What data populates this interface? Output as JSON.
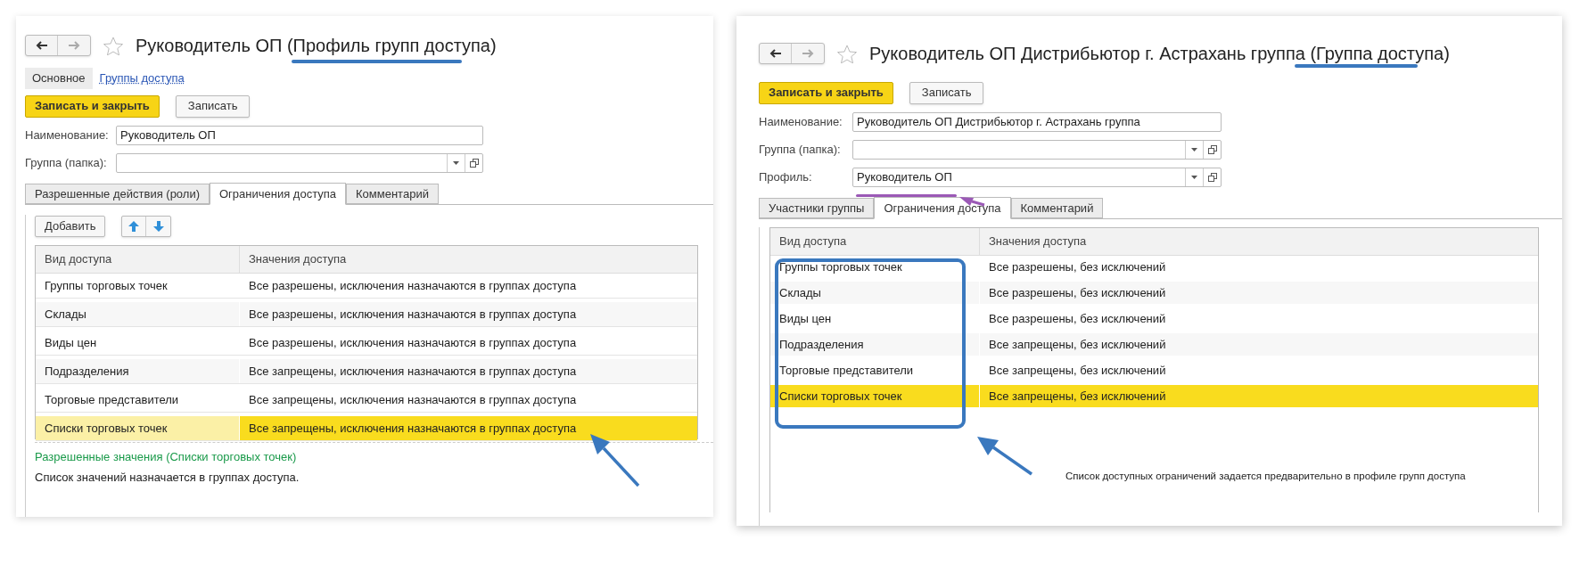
{
  "windows": [
    {
      "title": "Руководитель ОП (Профиль групп доступа)",
      "nav_tabs": [
        {
          "label": "Основное",
          "selected": true
        },
        {
          "label": "Группы доступа",
          "selected": false
        }
      ],
      "buttons": [
        {
          "label": "Записать и закрыть",
          "kind": "primary"
        },
        {
          "label": "Записать",
          "kind": "default"
        }
      ],
      "fields": [
        {
          "label": "Наименование:",
          "value": "Руководитель ОП",
          "kind": "text"
        },
        {
          "label": "Группа (папка):",
          "kind": "select"
        }
      ],
      "tabs": [
        {
          "label": "Разрешенные действия (роли)",
          "selected": false
        },
        {
          "label": "Ограничения доступа",
          "selected": true
        },
        {
          "label": "Комментарий",
          "selected": false
        }
      ],
      "toolbar": {
        "add_button": "Добавить"
      },
      "table": {
        "cell_cursor": true,
        "columns": [
          "Вид доступа",
          "Значения доступа"
        ],
        "rows": [
          {
            "cells": [
              "Группы торговых точек",
              "Все разрешены, исключения назначаются в группах доступа"
            ],
            "selected": false
          },
          {
            "cells": [
              "Склады",
              "Все разрешены, исключения назначаются в группах доступа"
            ],
            "selected": false
          },
          {
            "cells": [
              "Виды цен",
              "Все разрешены, исключения назначаются в группах доступа"
            ],
            "selected": false
          },
          {
            "cells": [
              "Подразделения",
              "Все запрещены, исключения назначаются в группах доступа"
            ],
            "selected": false
          },
          {
            "cells": [
              "Торговые представители",
              "Все запрещены, исключения назначаются в группах доступа"
            ],
            "selected": false
          },
          {
            "cells": [
              "Списки торговых точек",
              "Все запрещены, исключения назначаются в группах доступа"
            ],
            "selected": true
          }
        ]
      },
      "footer": {
        "title": "Разрешенные значения (Списки торговых точек)",
        "text": "Список значений назначается в группах доступа."
      }
    },
    {
      "title": "Руководитель ОП Дистрибьютор г. Астрахань группа (Группа доступа)",
      "buttons": [
        {
          "label": "Записать и закрыть",
          "kind": "primary"
        },
        {
          "label": "Записать",
          "kind": "default"
        }
      ],
      "fields": [
        {
          "label": "Наименование:",
          "value": "Руководитель ОП Дистрибьютор г. Астрахань группа",
          "kind": "text"
        },
        {
          "label": "Группа (папка):",
          "kind": "select"
        },
        {
          "label": "Профиль:",
          "value": "Руководитель ОП",
          "kind": "select"
        }
      ],
      "tabs": [
        {
          "label": "Участники группы",
          "selected": false
        },
        {
          "label": "Ограничения доступа",
          "selected": true
        },
        {
          "label": "Комментарий",
          "selected": false
        }
      ],
      "table": {
        "cell_cursor": false,
        "columns": [
          "Вид доступа",
          "Значения доступа"
        ],
        "rows": [
          {
            "cells": [
              "Группы торговых точек",
              "Все разрешены, без исключений"
            ],
            "selected": false
          },
          {
            "cells": [
              "Склады",
              "Все разрешены, без исключений"
            ],
            "selected": false
          },
          {
            "cells": [
              "Виды цен",
              "Все разрешены, без исключений"
            ],
            "selected": false
          },
          {
            "cells": [
              "Подразделения",
              "Все запрещены, без исключений"
            ],
            "selected": false
          },
          {
            "cells": [
              "Торговые представители",
              "Все запрещены, без исключений"
            ],
            "selected": false
          },
          {
            "cells": [
              "Списки торговых точек",
              "Все запрещены, без исключений"
            ],
            "selected": true
          }
        ]
      }
    }
  ],
  "annotation_text": "Список доступных ограничений задается предварительно в профиле групп доступа"
}
